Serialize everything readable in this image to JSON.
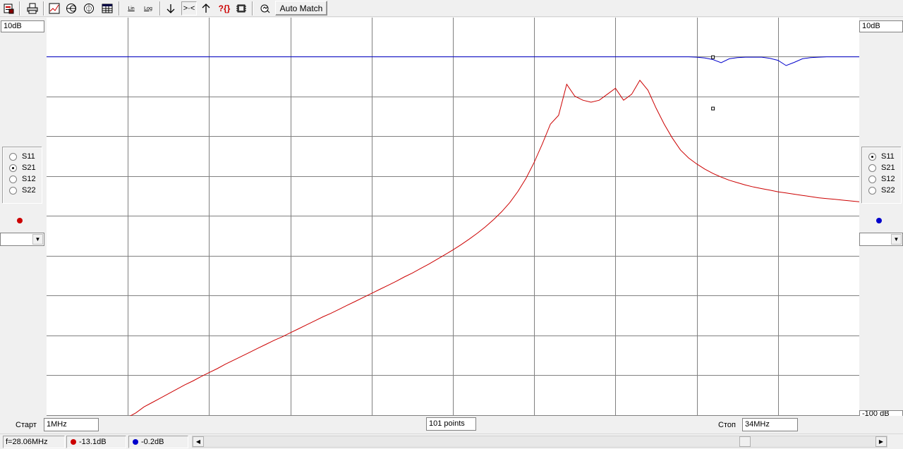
{
  "toolbar": {
    "lin_label": "Lin",
    "log_label": "Log",
    "auto_match_label": "Auto Match",
    "match_glyph": ">·<",
    "help_glyph": "?{}"
  },
  "left_panel": {
    "scale": "10dB",
    "params": [
      "S11",
      "S21",
      "S12",
      "S22"
    ],
    "selected": "S21",
    "trace_color": "#cc0000"
  },
  "right_panel": {
    "scale": "10dB",
    "scale_bottom": "-100 dB",
    "params": [
      "S11",
      "S21",
      "S12",
      "S22"
    ],
    "selected": "S11",
    "trace_color": "#0000cc"
  },
  "bottom": {
    "start_label": "Старт",
    "start_value": "1MHz",
    "points_value": "101 points",
    "stop_label": "Стоп",
    "stop_value": "34MHz"
  },
  "status": {
    "frequency": "f=28.06MHz",
    "marker1_value": "-13.1dB",
    "marker2_value": "-0.2dB"
  },
  "chart_data": {
    "type": "line",
    "x_range_mhz": [
      1,
      34
    ],
    "grid": true,
    "series": [
      {
        "param": "S21",
        "color": "#cc0000",
        "y_db": [
          -91.1,
          -91.1,
          -91.1,
          -91.1,
          -91.1,
          -91.1,
          -91.1,
          -91.1,
          -91.1,
          -91.1,
          -90.7,
          -89.5,
          -88.0,
          -86.9,
          -85.8,
          -84.7,
          -83.6,
          -82.5,
          -81.5,
          -80.4,
          -79.4,
          -78.4,
          -77.3,
          -76.3,
          -75.3,
          -74.3,
          -73.3,
          -72.3,
          -71.3,
          -70.4,
          -69.4,
          -68.4,
          -67.4,
          -66.4,
          -65.4,
          -64.5,
          -63.5,
          -62.5,
          -61.5,
          -60.5,
          -59.5,
          -58.5,
          -57.5,
          -56.5,
          -55.4,
          -54.4,
          -53.3,
          -52.2,
          -51.0,
          -49.8,
          -48.6,
          -47.3,
          -45.9,
          -44.4,
          -42.8,
          -41.0,
          -39.0,
          -36.7,
          -33.9,
          -30.6,
          -26.6,
          -22.0,
          -17.0,
          -14.8,
          -7.0,
          -10.0,
          -11.0,
          -11.5,
          -11.0,
          -9.5,
          -8.0,
          -11.0,
          -9.5,
          -6.0,
          -8.5,
          -13.0,
          -17.0,
          -20.5,
          -23.5,
          -25.5,
          -27.0,
          -28.3,
          -29.4,
          -30.3,
          -31.1,
          -31.7,
          -32.3,
          -32.8,
          -33.2,
          -33.6,
          -34.0,
          -34.3,
          -34.6,
          -34.9,
          -35.2,
          -35.5,
          -35.7,
          -35.9,
          -36.1,
          -36.3,
          -36.5
        ],
        "marker_index": 82,
        "marker_value_db": -13.1
      },
      {
        "param": "S11",
        "color": "#0000cc",
        "y_db": [
          -0.1,
          -0.1,
          -0.1,
          -0.1,
          -0.1,
          -0.1,
          -0.1,
          -0.1,
          -0.1,
          -0.1,
          -0.1,
          -0.1,
          -0.1,
          -0.1,
          -0.1,
          -0.1,
          -0.1,
          -0.1,
          -0.1,
          -0.1,
          -0.1,
          -0.1,
          -0.1,
          -0.1,
          -0.1,
          -0.1,
          -0.1,
          -0.1,
          -0.1,
          -0.1,
          -0.1,
          -0.1,
          -0.1,
          -0.1,
          -0.1,
          -0.1,
          -0.1,
          -0.1,
          -0.1,
          -0.1,
          -0.1,
          -0.1,
          -0.1,
          -0.1,
          -0.1,
          -0.1,
          -0.1,
          -0.1,
          -0.1,
          -0.1,
          -0.1,
          -0.1,
          -0.1,
          -0.1,
          -0.1,
          -0.1,
          -0.1,
          -0.1,
          -0.1,
          -0.1,
          -0.1,
          -0.1,
          -0.1,
          -0.1,
          -0.1,
          -0.1,
          -0.1,
          -0.1,
          -0.1,
          -0.1,
          -0.1,
          -0.1,
          -0.1,
          -0.1,
          -0.1,
          -0.1,
          -0.1,
          -0.1,
          -0.1,
          -0.1,
          -0.2,
          -0.4,
          -0.8,
          -1.6,
          -0.6,
          -0.3,
          -0.2,
          -0.2,
          -0.2,
          -0.5,
          -1.0,
          -2.3,
          -1.5,
          -0.6,
          -0.3,
          -0.2,
          -0.1,
          -0.1,
          -0.1,
          -0.1,
          -0.1
        ],
        "marker_index": 82,
        "marker_value_db": -0.2
      }
    ]
  }
}
